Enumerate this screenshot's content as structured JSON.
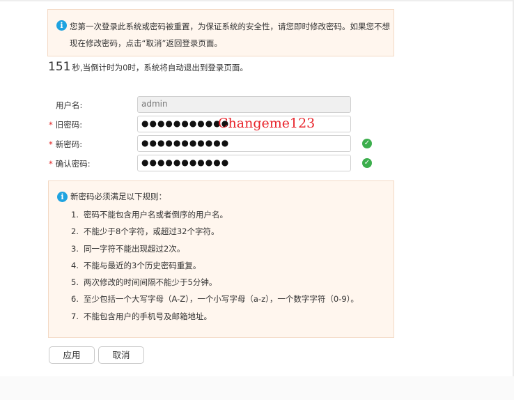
{
  "notice": {
    "icon": "info-icon",
    "text": "您第一次登录此系统或密码被重置，为保证系统的安全性，请您即时修改密码。如果您不想现在修改密码，点击“取消”返回登录页面。"
  },
  "countdown": {
    "seconds": "151",
    "text": "秒,当倒计时为0时，系统将自动退出到登录页面。"
  },
  "form": {
    "username": {
      "label": "用户名:",
      "value": "admin"
    },
    "old_password": {
      "required": "*",
      "label": "旧密码:",
      "value": "●●●●●●●●●●●"
    },
    "new_password": {
      "required": "*",
      "label": "新密码:",
      "value": "●●●●●●●●●●●"
    },
    "confirm_password": {
      "required": "*",
      "label": "确认密码:",
      "value": "●●●●●●●●●●●"
    }
  },
  "annotation": "Changeme123",
  "rules": {
    "title": "新密码必须满足以下规则：",
    "items": [
      {
        "num": "1.",
        "text": "密码不能包含用户名或者倒序的用户名。"
      },
      {
        "num": "2.",
        "text": "不能少于8个字符，或超过32个字符。"
      },
      {
        "num": "3.",
        "text": "同一字符不能出现超过2次。"
      },
      {
        "num": "4.",
        "text": "不能与最近的3个历史密码重复。"
      },
      {
        "num": "5.",
        "text": "两次修改的时间间隔不能少于5分钟。"
      },
      {
        "num": "6.",
        "text": "至少包括一个大写字母（A-Z），一个小写字母（a-z），一个数字字符（0-9）。"
      },
      {
        "num": "7.",
        "text": "不能包含用户的手机号及邮箱地址。"
      }
    ]
  },
  "buttons": {
    "apply": "应用",
    "cancel": "取消"
  },
  "colors": {
    "accent": "#1fa3e0",
    "required": "#e02020",
    "valid": "#3cae4d",
    "annotation": "#e8232a",
    "notice_bg": "#fff6ee"
  }
}
